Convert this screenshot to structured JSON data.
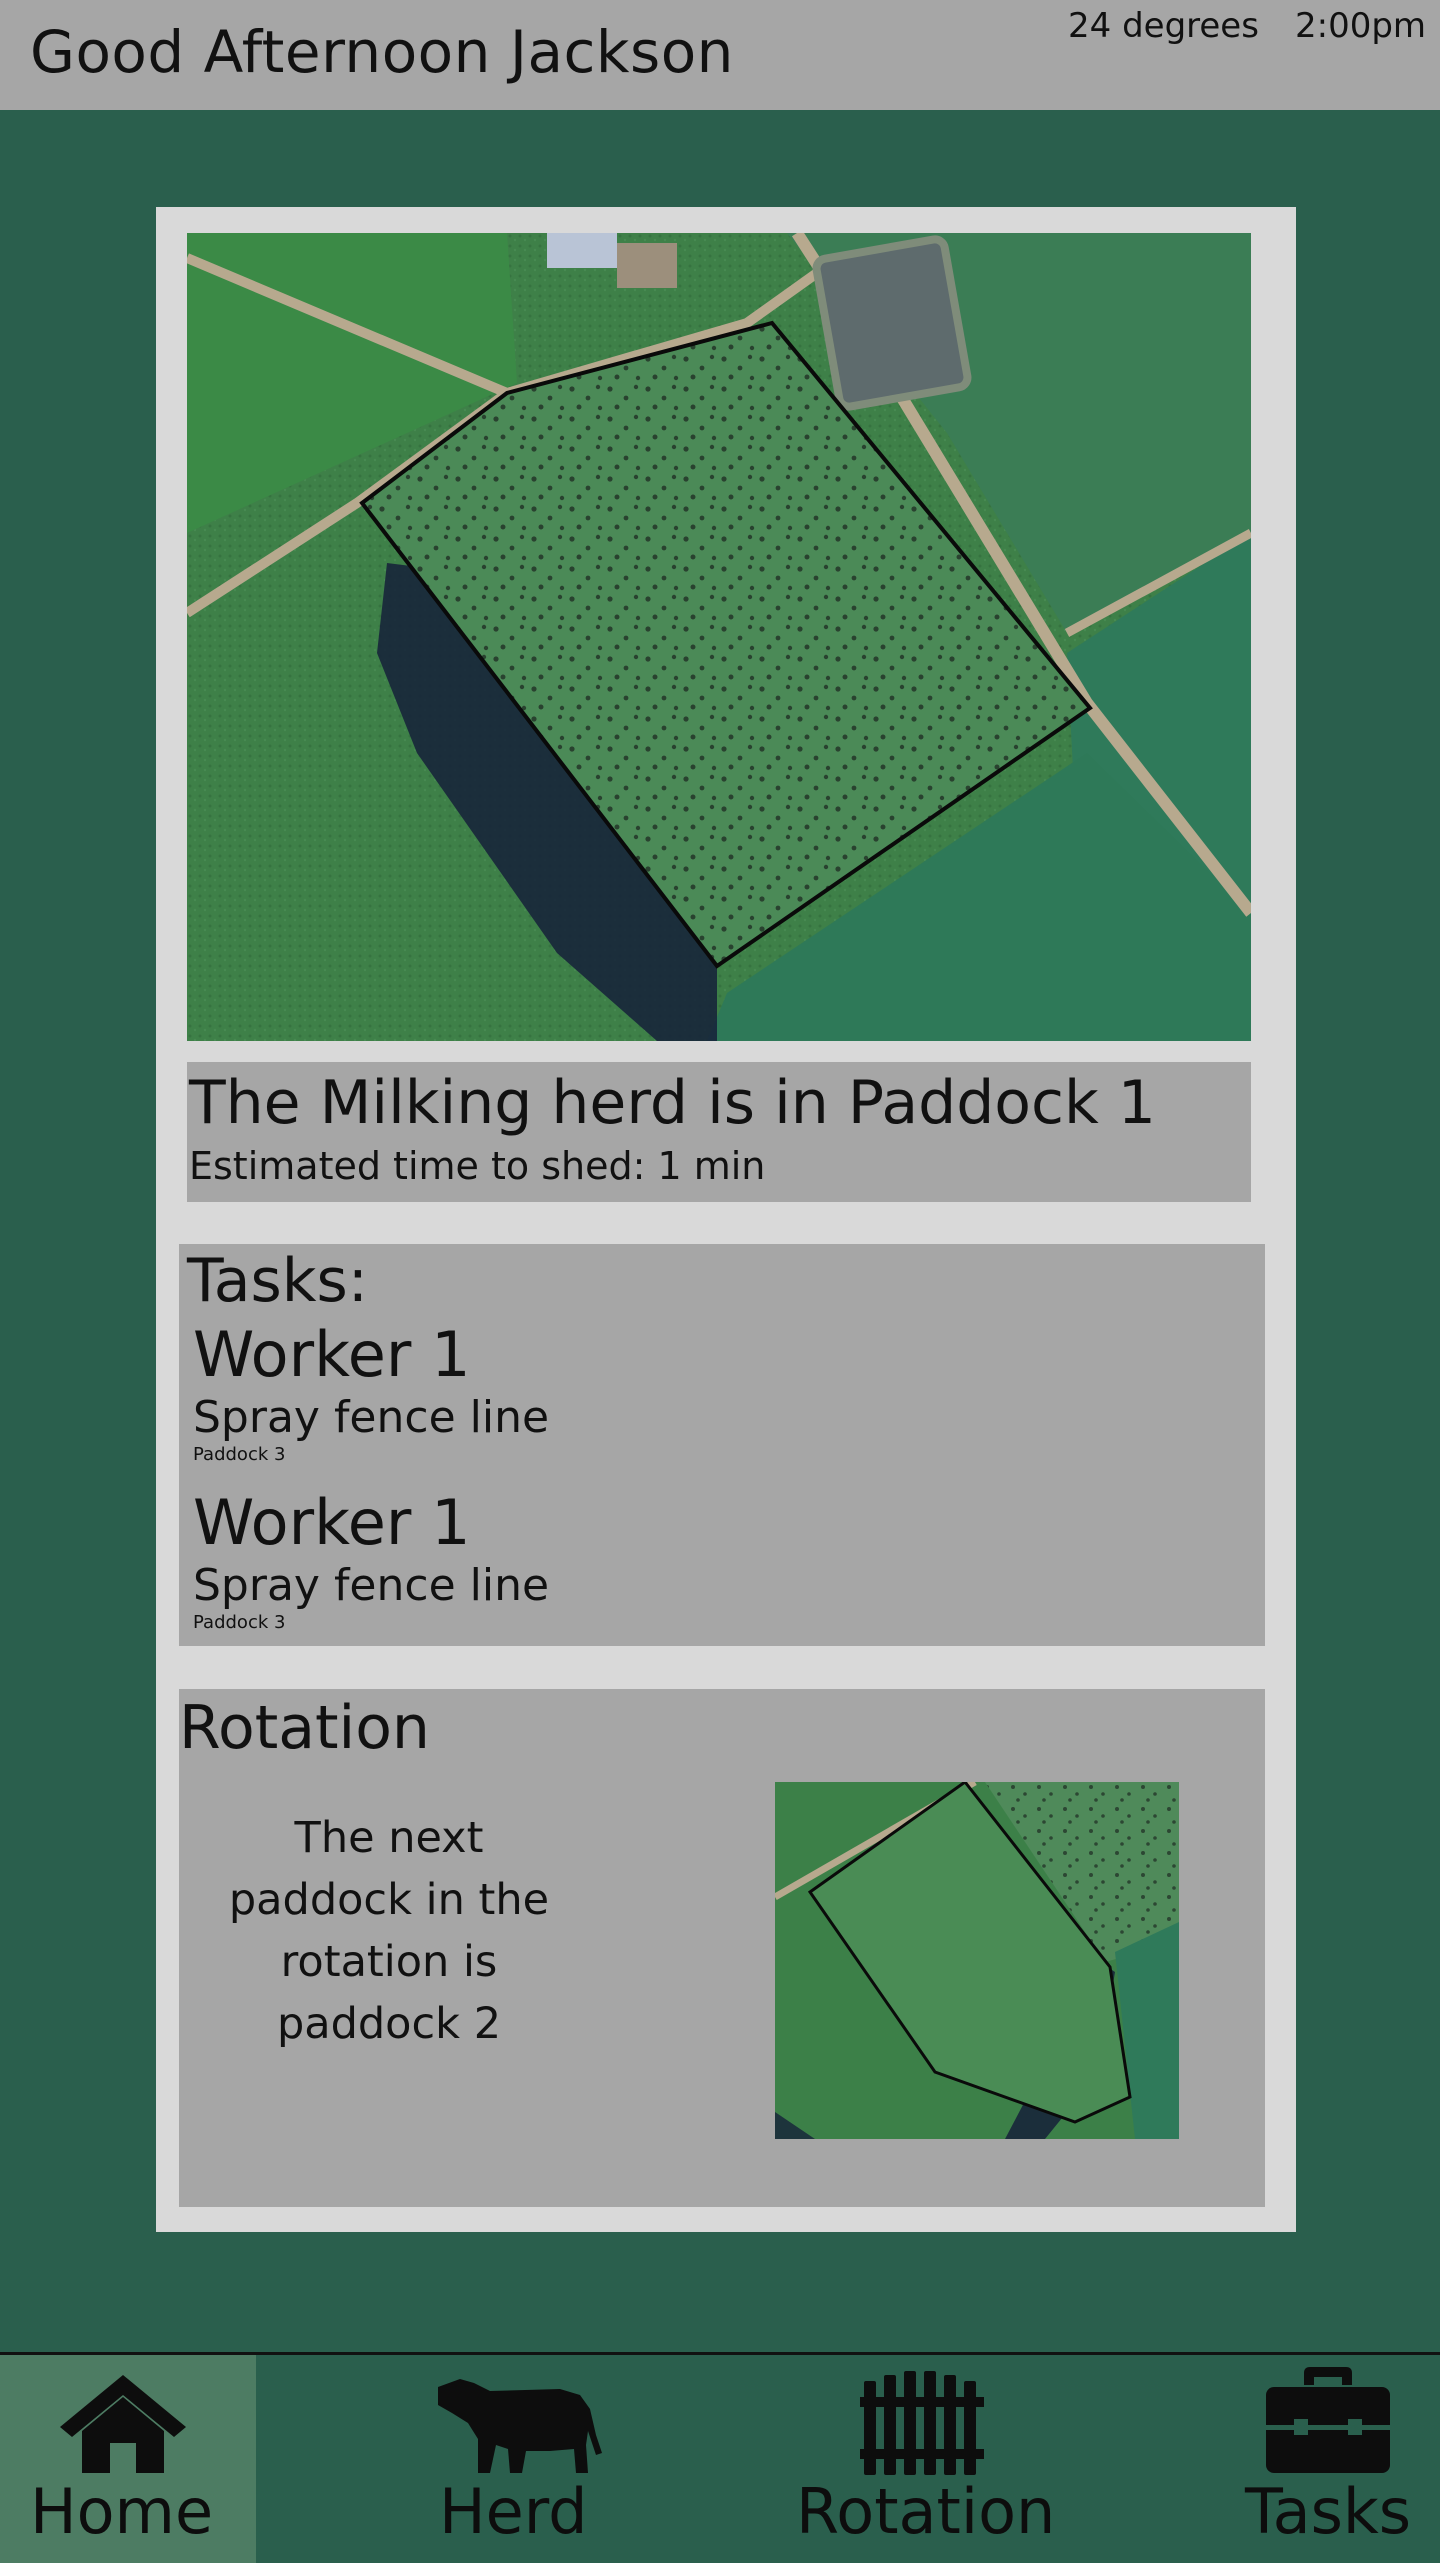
{
  "header": {
    "greeting": "Good Afternoon Jackson",
    "temperature": "24 degrees",
    "time": "2:00pm"
  },
  "herd_status": {
    "title": "The Milking herd is in Paddock 1",
    "eta": "Estimated time to shed: 1 min",
    "map_icon": "satellite-paddock-1-map"
  },
  "tasks": {
    "heading": "Tasks:",
    "items": [
      {
        "worker": "Worker 1",
        "task": "Spray fence line",
        "location": "Paddock 3"
      },
      {
        "worker": "Worker 1",
        "task": "Spray fence line",
        "location": "Paddock 3"
      }
    ]
  },
  "rotation": {
    "heading": "Rotation",
    "message": "The next paddock in the rotation is paddock 2",
    "map_icon": "satellite-paddock-2-map"
  },
  "nav": {
    "items": [
      {
        "label": "Home",
        "icon": "home-icon",
        "active": true
      },
      {
        "label": "Herd",
        "icon": "cow-icon",
        "active": false
      },
      {
        "label": "Rotation",
        "icon": "fence-icon",
        "active": false
      },
      {
        "label": "Tasks",
        "icon": "briefcase-icon",
        "active": false
      }
    ]
  },
  "colors": {
    "background": "#2a5f4d",
    "header": "#a6a6a6",
    "card": "#d9d9d9",
    "panel": "#a6a6a6",
    "nav_active": "#4d7c63"
  }
}
